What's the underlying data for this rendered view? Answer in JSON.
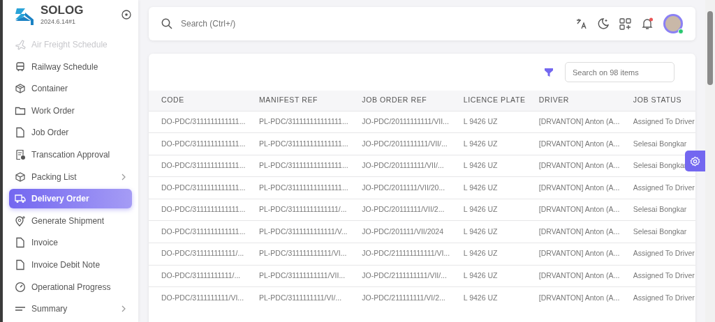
{
  "brand": {
    "name": "SOLOG",
    "version": "2024.6.14#1"
  },
  "sidebar": {
    "items": [
      {
        "label": "Air Freight Schedule",
        "kind": "plane",
        "selected": false,
        "disabled": true,
        "expandable": false
      },
      {
        "label": "Railway Schedule",
        "kind": "train",
        "selected": false,
        "disabled": false,
        "expandable": false
      },
      {
        "label": "Container",
        "kind": "box",
        "selected": false,
        "disabled": false,
        "expandable": false
      },
      {
        "label": "Work Order",
        "kind": "folder",
        "selected": false,
        "disabled": false,
        "expandable": false
      },
      {
        "label": "Job Order",
        "kind": "file",
        "selected": false,
        "disabled": false,
        "expandable": false
      },
      {
        "label": "Transcation Approval",
        "kind": "approval",
        "selected": false,
        "disabled": false,
        "expandable": false
      },
      {
        "label": "Packing List",
        "kind": "package",
        "selected": false,
        "disabled": false,
        "expandable": true
      },
      {
        "label": "Delivery Order",
        "kind": "truck",
        "selected": true,
        "disabled": false,
        "expandable": false
      },
      {
        "label": "Generate Shipment",
        "kind": "pin",
        "selected": false,
        "disabled": false,
        "expandable": false
      },
      {
        "label": "Invoice",
        "kind": "file",
        "selected": false,
        "disabled": false,
        "expandable": false
      },
      {
        "label": "Invoice Debit Note",
        "kind": "file",
        "selected": false,
        "disabled": false,
        "expandable": false
      },
      {
        "label": "Operational Progress",
        "kind": "gauge",
        "selected": false,
        "disabled": false,
        "expandable": false
      },
      {
        "label": "Summary",
        "kind": "lines",
        "selected": false,
        "disabled": false,
        "expandable": true
      }
    ]
  },
  "topbar": {
    "search": {
      "placeholder": "Search (Ctrl+/)"
    },
    "notifications_unread": true,
    "user_online": true
  },
  "table": {
    "filter": {
      "placeholder": "Search on 98 items"
    },
    "columns": [
      "CODE",
      "MANIFEST REF",
      "JOB ORDER REF",
      "LICENCE PLATE",
      "DRIVER",
      "JOB STATUS"
    ],
    "rows": [
      [
        "DO-PDC/3111111111111...",
        "PL-PDC/311111111111111...",
        "JO-PDC/20111111111/VII...",
        "L 9426 UZ",
        "[DRVANTON] Anton (A...",
        "Assigned To Driver"
      ],
      [
        "DO-PDC/3111111111111...",
        "PL-PDC/311111111111111...",
        "JO-PDC/2011111111/VII/...",
        "L 9426 UZ",
        "[DRVANTON] Anton (A...",
        "Selesai Bongkar"
      ],
      [
        "DO-PDC/3111111111111...",
        "PL-PDC/311111111111111...",
        "JO-PDC/201111111/VII/...",
        "L 9426 UZ",
        "[DRVANTON] Anton (A...",
        "Selesai Bongkar"
      ],
      [
        "DO-PDC/3111111111111...",
        "PL-PDC/311111111111111...",
        "JO-PDC/2011111/VII/20...",
        "L 9426 UZ",
        "[DRVANTON] Anton (A...",
        "Assigned To Driver"
      ],
      [
        "DO-PDC/3111111111111...",
        "PL-PDC/31111111111111/...",
        "JO-PDC/20111111/VII/2...",
        "L 9426 UZ",
        "[DRVANTON] Anton (A...",
        "Selesai Bongkar"
      ],
      [
        "DO-PDC/3111111111111...",
        "PL-PDC/3111111111111/V...",
        "JO-PDC/201111/VII/2024",
        "L 9426 UZ",
        "[DRVANTON] Anton (A...",
        "Selesai Bongkar"
      ],
      [
        "DO-PDC/311111111111/...",
        "PL-PDC/311111111111/VI...",
        "JO-PDC/211111111111/VI...",
        "L 9426 UZ",
        "[DRVANTON] Anton (A...",
        "Assigned To Driver"
      ],
      [
        "DO-PDC/31111111111/...",
        "PL-PDC/31111111111/VII...",
        "JO-PDC/2111111111/VII/...",
        "L 9426 UZ",
        "[DRVANTON] Anton (A...",
        "Assigned To Driver"
      ],
      [
        "DO-PDC/3111111111/VI...",
        "PL-PDC/3111111111/VI/...",
        "JO-PDC/211111111/VI/2...",
        "L 9426 UZ",
        "[DRVANTON] Anton (A...",
        "Assigned To Driver"
      ]
    ]
  }
}
